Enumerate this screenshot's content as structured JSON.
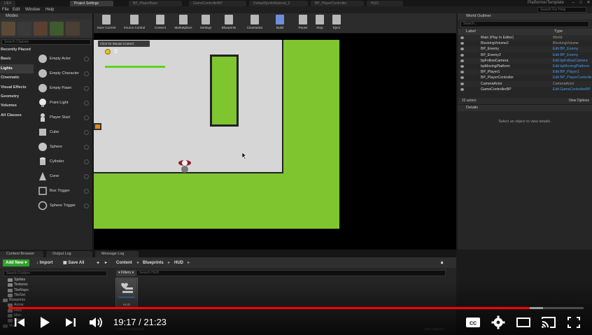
{
  "tabstrip": {
    "tabs": [
      "UE4",
      "Project Settings",
      "BP_PlayerBase",
      "GameControllerBP",
      "DefaultSpriteMaterial_2",
      "BP_PlayerController",
      "HUD"
    ],
    "project_title": "PlatformerTemplate"
  },
  "menubar": {
    "items": [
      "File",
      "Edit",
      "Window",
      "Help"
    ],
    "search_placeholder": "Search For Help"
  },
  "modes": {
    "title": "Modes",
    "search_placeholder": "Search Classes",
    "categories": [
      "Recently Placed",
      "Basic",
      "Lights",
      "Cinematic",
      "Visual Effects",
      "Geometry",
      "Volumes",
      "All Classes"
    ],
    "actors": [
      "Empty Actor",
      "Empty Character",
      "Empty Pawn",
      "Point Light",
      "Player Start",
      "Cube",
      "Sphere",
      "Cylinder",
      "Cone",
      "Box Trigger",
      "Sphere Trigger"
    ]
  },
  "toolbar": [
    "Save Current",
    "Source Control",
    "Content",
    "Marketplace",
    "Settings",
    "Blueprints",
    "Cinematics",
    "Build",
    "Pause",
    "Stop",
    "Eject"
  ],
  "viewport": {
    "mouse_banner": "Click for Mouse Control",
    "coin_count": "0",
    "health_fraction": 0.45
  },
  "outliner": {
    "title": "World Outliner",
    "search_placeholder": "Search...",
    "col_label": "Label",
    "col_type": "Type",
    "rows": [
      {
        "label": "Main (Play In Editor)",
        "type": "World",
        "link": false
      },
      {
        "label": "BlockingVolume2",
        "type": "BlockingVolume",
        "link": false
      },
      {
        "label": "BP_Enemy",
        "type": "Edit BP_Enemy",
        "link": true
      },
      {
        "label": "BP_Enemy2",
        "type": "Edit BP_Enemy",
        "link": true
      },
      {
        "label": "bpFollowCamera",
        "type": "Edit bpFollowCamera",
        "link": true
      },
      {
        "label": "bpMovingPlatform",
        "type": "Edit bpMovingPlatform",
        "link": true
      },
      {
        "label": "BP_Player1",
        "type": "Edit BP_Player1",
        "link": true
      },
      {
        "label": "BP_PlayerController",
        "type": "Edit BP_PlayerController",
        "link": true
      },
      {
        "label": "CameraActor",
        "type": "CameraActor",
        "link": false
      },
      {
        "label": "GameControllerBP",
        "type": "Edit GameControllerBP",
        "link": true
      }
    ],
    "actor_count": "22 actors",
    "view_options": "View Options"
  },
  "details": {
    "title": "Details",
    "message": "Select an object to view details."
  },
  "content_browser": {
    "tabs": [
      "Content Browser",
      "Output Log",
      "Message Log"
    ],
    "add_new": "Add New",
    "import": "Import",
    "save_all": "Save All",
    "breadcrumbs": [
      "Content",
      "Blueprints",
      "HUD"
    ],
    "folder_search": "Search Folders",
    "filters": "Filters",
    "asset_search": "Search HUD",
    "folders": [
      {
        "name": "Sprites",
        "depth": 1
      },
      {
        "name": "Textures",
        "depth": 1
      },
      {
        "name": "TileMaps",
        "depth": 1
      },
      {
        "name": "TileSet",
        "depth": 1
      },
      {
        "name": "Blueprints",
        "depth": 0
      },
      {
        "name": "Arrow",
        "depth": 1
      },
      {
        "name": "HUD",
        "depth": 1
      },
      {
        "name": "Misc",
        "depth": 1
      },
      {
        "name": "Player",
        "depth": 1
      },
      {
        "name": "Map",
        "depth": 0
      }
    ],
    "asset_name": "HUD",
    "item_count": "1 item (1 selected)",
    "view_options": "View Options"
  },
  "video": {
    "time_text": "19:17 / 21:23",
    "played_fraction": 0.9067,
    "buffered_fraction": 0.93,
    "accent": "#ff0000"
  }
}
